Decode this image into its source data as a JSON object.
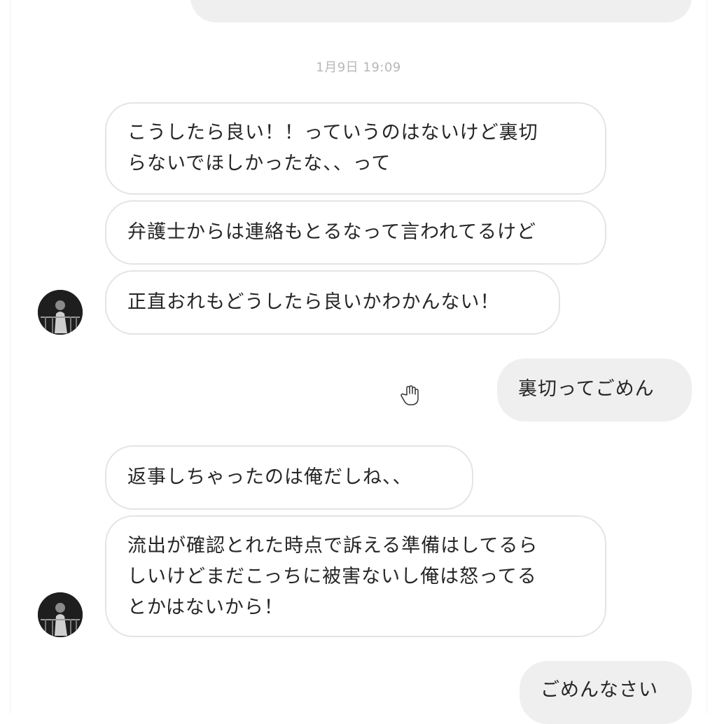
{
  "conversation": {
    "timestamp": "1月9日 19:09",
    "messages": [
      {
        "direction": "incoming",
        "text": "こうしたら良い！！っていうのはないけど裏切\nらないでほしかったな、、って"
      },
      {
        "direction": "incoming",
        "text": "弁護士からは連絡もとるなって言われてるけど"
      },
      {
        "direction": "incoming",
        "text": "正直おれもどうしたら良いかわかんない！"
      },
      {
        "direction": "outgoing",
        "text": "裏切ってごめん"
      },
      {
        "direction": "incoming",
        "text": "返事しちゃったのは俺だしね、、"
      },
      {
        "direction": "incoming",
        "text": "流出が確認とれた時点で訴える準備はしてるら\nしいけどまだこっちに被害ないし俺は怒ってる\nとかはないから！"
      },
      {
        "direction": "outgoing",
        "text": "ごめんなさい"
      }
    ]
  },
  "icons": {
    "avatar": "contact-avatar",
    "cursor": "hand-pointer-icon"
  }
}
